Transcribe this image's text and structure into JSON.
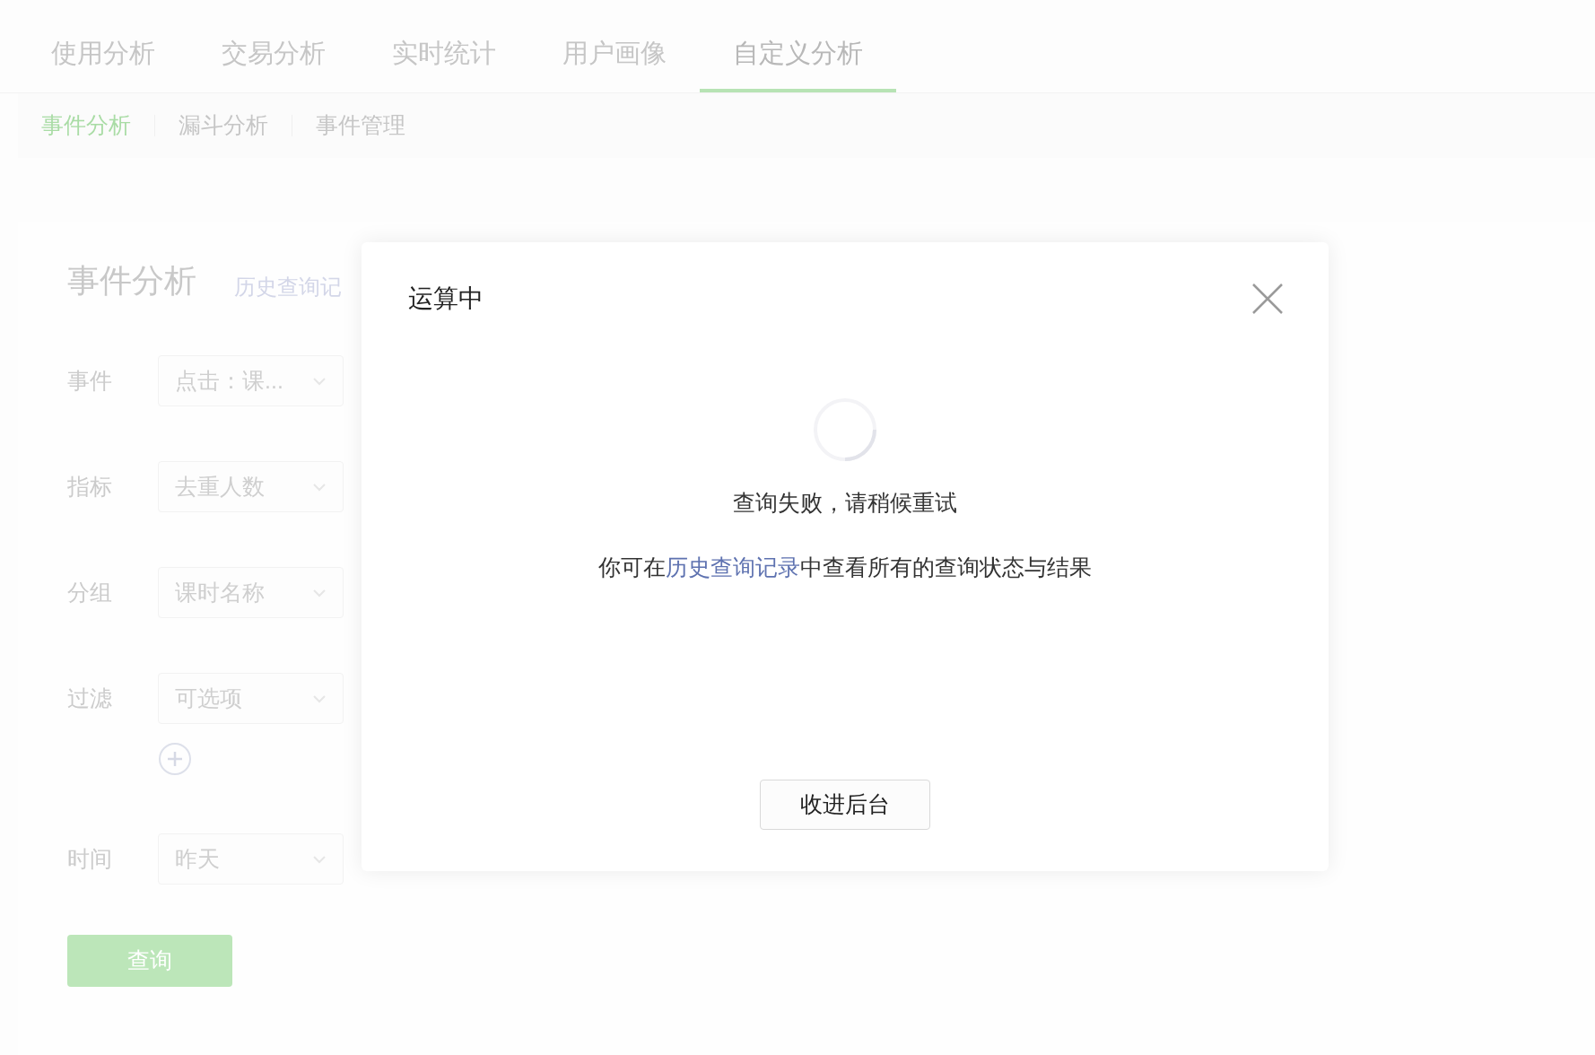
{
  "tabs": [
    {
      "label": "使用分析",
      "selected": false
    },
    {
      "label": "交易分析",
      "selected": false
    },
    {
      "label": "实时统计",
      "selected": false
    },
    {
      "label": "用户画像",
      "selected": false
    },
    {
      "label": "自定义分析",
      "selected": true
    }
  ],
  "subtabs": [
    {
      "label": "事件分析",
      "selected": true
    },
    {
      "label": "漏斗分析",
      "selected": false
    },
    {
      "label": "事件管理",
      "selected": false
    }
  ],
  "panel": {
    "title": "事件分析",
    "history_link": "历史查询记",
    "fields": [
      {
        "label": "事件",
        "value": "点击：课..."
      },
      {
        "label": "指标",
        "value": "去重人数"
      },
      {
        "label": "分组",
        "value": "课时名称"
      },
      {
        "label": "过滤",
        "value": "可选项",
        "addable": true
      },
      {
        "label": "时间",
        "value": "昨天"
      }
    ],
    "submit": "查询"
  },
  "dialog": {
    "title": "运算中",
    "message": "查询失败，请稍候重试",
    "hint_before": "你可在",
    "hint_link": "历史查询记录",
    "hint_after": "中查看所有的查询状态与结果",
    "button": "收进后台"
  }
}
